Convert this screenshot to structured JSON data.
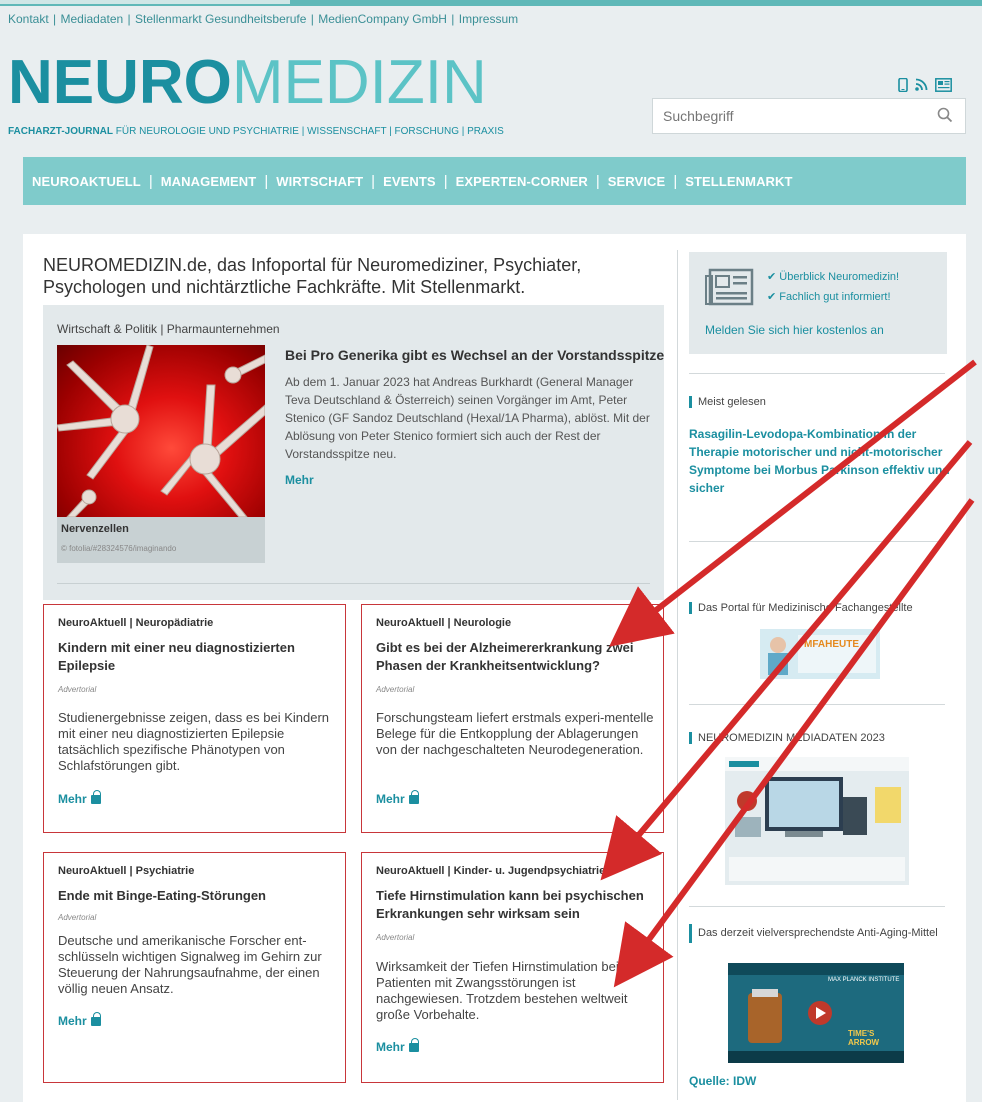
{
  "top_links": [
    "Kontakt",
    "Mediadaten",
    "Stellenmarkt Gesundheitsberufe",
    "MedienCompany GmbH",
    "Impressum"
  ],
  "logo": {
    "part1": "NEURO",
    "part2": "MEDIZIN"
  },
  "tagline": {
    "bold": "FACHARZT-JOURNAL",
    "rest": " FÜR NEUROLOGIE UND PSYCHIATRIE | WISSENSCHAFT | FORSCHUNG | PRAXIS"
  },
  "header_icons": [
    "mobile-icon",
    "rss-icon",
    "newsletter-icon"
  ],
  "search": {
    "placeholder": "Suchbegriff"
  },
  "nav": [
    "NEUROAKTUELL",
    "MANAGEMENT",
    "WIRTSCHAFT",
    "EVENTS",
    "EXPERTEN-CORNER",
    "SERVICE",
    "STELLENMARKT"
  ],
  "intro": "NEUROMEDIZIN.de, das Infoportal für Neuromediziner, Psychiater, Psychologen und nichtärztliche Fachkräfte. Mit Stellenmarkt.",
  "feature": {
    "category": "Wirtschaft & Politik | Pharmaunternehmen",
    "image_caption": "Nervenzellen",
    "image_credit": "© fotolia/#28324576/imaginando",
    "title": "Bei Pro Generika gibt es Wechsel an der Vorstandsspitze",
    "text": "Ab dem 1. Januar 2023 hat Andreas Burkhardt (General Manager Teva Deutschland & Österreich) seinen Vorgänger im Amt, Peter Stenico (GF Sandoz Deutschland (Hexal/1A Pharma), ablöst. Mit der Ablösung von Peter Stenico formiert sich auch der Rest der Vorstandsspitze neu.",
    "more": "Mehr"
  },
  "cards": [
    {
      "category": "NeuroAktuell | Neuropädiatrie",
      "title": "Kindern mit einer neu diagnostizierten Epilepsie",
      "advertorial": "Advertorial",
      "body": "Studienergebnisse zeigen, dass es bei Kindern mit einer neu diagnostizierten Epilepsie tatsächlich spezifische Phänotypen von Schlafstörungen gibt.",
      "more": "Mehr"
    },
    {
      "category": "NeuroAktuell | Neurologie",
      "title": "Gibt es bei der Alzheimererkrankung zwei Phasen der Krankheitsentwicklung?",
      "advertorial": "Advertorial",
      "body": "Forschungsteam liefert erstmals experi-mentelle Belege für die Entkopplung der Ablagerungen von der nachgeschalteten Neurodegeneration.",
      "more": "Mehr"
    },
    {
      "category": "NeuroAktuell | Psychiatrie",
      "title": "Ende mit Binge-Eating-Störungen",
      "advertorial": "Advertorial",
      "body": "Deutsche und amerikanische Forscher ent-schlüsseln wichtigen Signalweg im Gehirn zur Steuerung der Nahrungsaufnahme, der einen völlig neuen Ansatz.",
      "more": "Mehr"
    },
    {
      "category": "NeuroAktuell | Kinder- u. Jugendpsychiatrie",
      "title": "Tiefe Hirnstimulation kann bei psychischen Erkrankungen sehr wirksam sein",
      "advertorial": "Advertorial",
      "body": "Wirksamkeit der Tiefen Hirnstimulation bei Patienten mit Zwangsstörungen ist nachgewiesen. Trotzdem bestehen weltweit große Vorbehalte.",
      "more": "Mehr"
    }
  ],
  "sidebar": {
    "newsletter": {
      "check1": "✔ Überblick Neuromedizin!",
      "check2": "✔ Fachlich gut informiert!",
      "link": "Melden Sie sich hier kostenlos an"
    },
    "meist_gelesen": {
      "heading": "Meist gelesen",
      "link": "Rasagilin-Levodopa-Kombination in der Therapie motorischer und nicht-motorischer Symptome bei Morbus Parkinson effektiv und sicher"
    },
    "portal": {
      "heading": "Das Portal für Medizinische Fachangestellte",
      "banner_logo": "MFAHEUTE"
    },
    "mediadaten": {
      "heading": "NEUROMEDIZIN MEDIADATEN 2023"
    },
    "antiaging": {
      "heading": "Das derzeit vielversprechendste Anti-Aging-Mittel",
      "banner_institute": "MAX PLANCK INSTITUTE",
      "banner_title": "TIME'S ARROW"
    },
    "quelle": "Quelle: IDW"
  },
  "colors": {
    "brand": "#1b8fa0",
    "nav_bg": "#7fcbcb",
    "card_border": "#c8363a",
    "arrow": "#d42a2a"
  }
}
